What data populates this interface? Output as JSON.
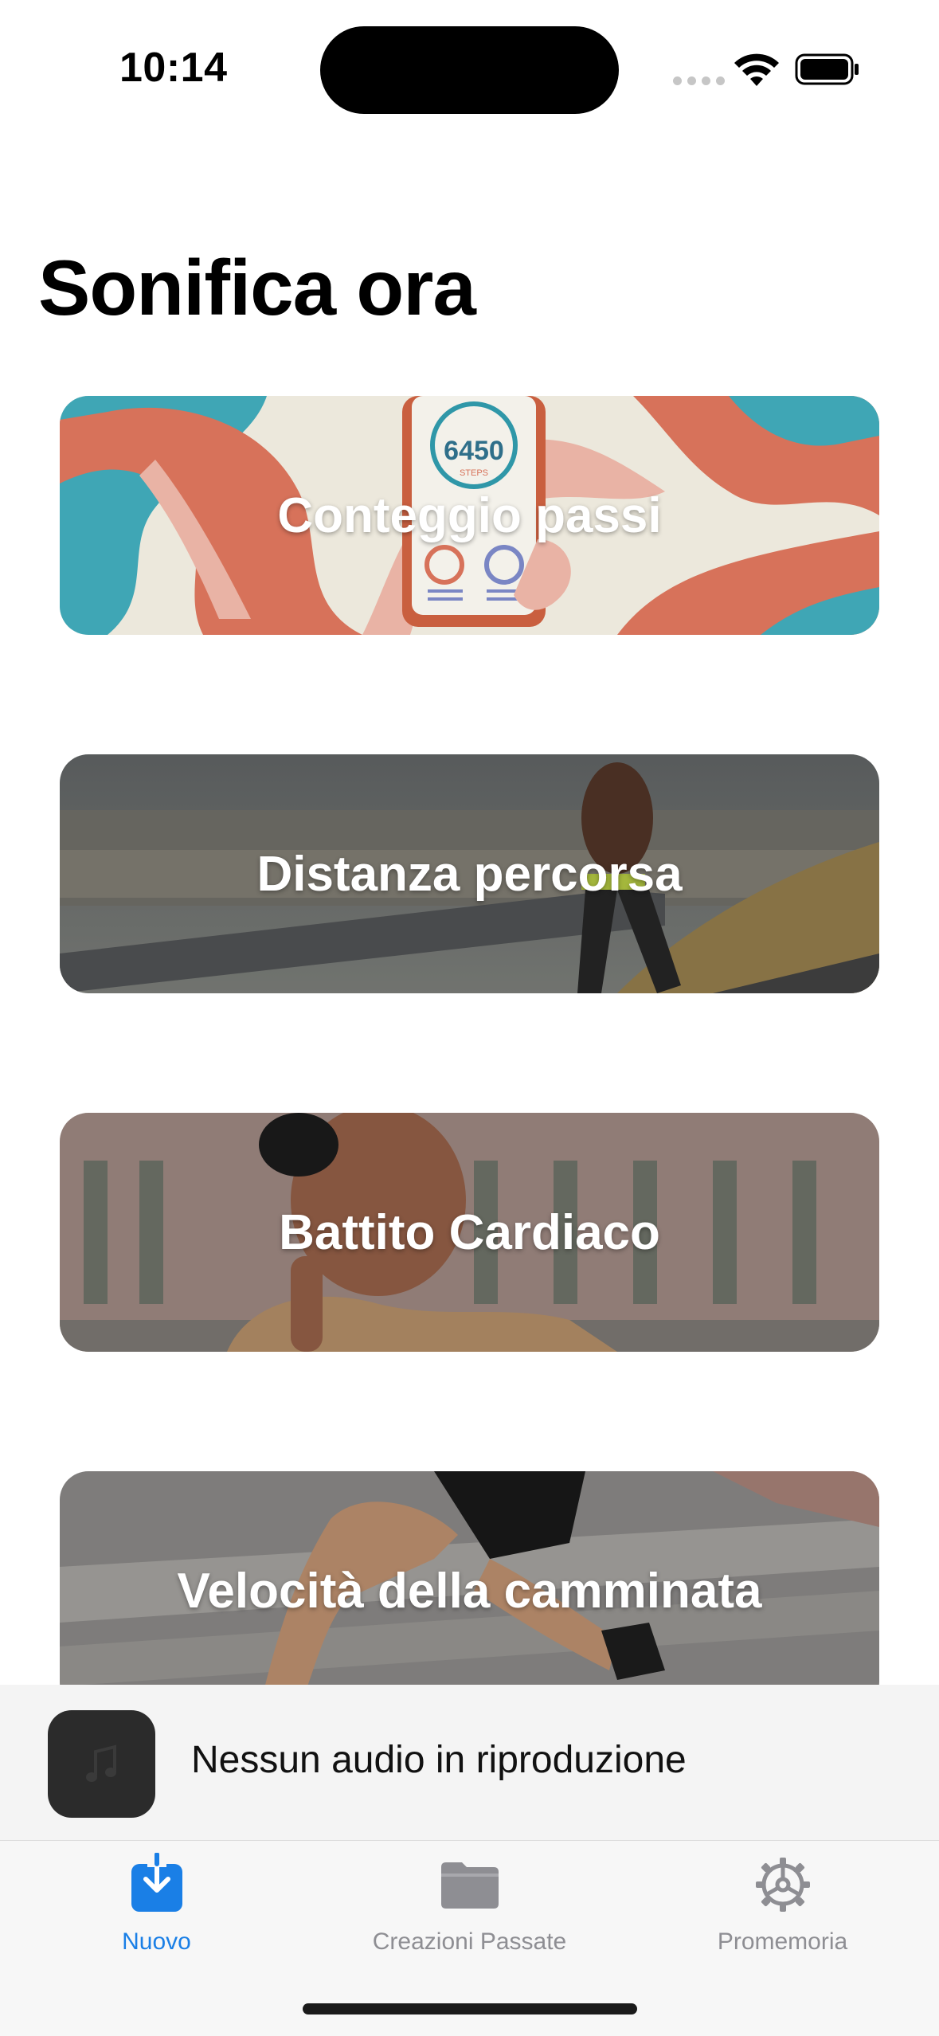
{
  "status_bar": {
    "time": "10:14"
  },
  "page": {
    "title": "Sonifica ora"
  },
  "cards": [
    {
      "label": "Conteggio passi",
      "image_text": "6450",
      "image_subtext": "STEPS"
    },
    {
      "label": "Distanza percorsa"
    },
    {
      "label": "Battito Cardiaco"
    },
    {
      "label": "Velocità della camminata"
    }
  ],
  "mini_player": {
    "status": "Nessun audio in riproduzione",
    "artwork_icon": "music-note-icon"
  },
  "tabs": [
    {
      "label": "Nuovo",
      "icon": "download-tray-icon",
      "active": true
    },
    {
      "label": "Creazioni Passate",
      "icon": "folder-icon",
      "active": false
    },
    {
      "label": "Promemoria",
      "icon": "gear-icon",
      "active": false
    }
  ],
  "colors": {
    "accent": "#1a7fe6",
    "inactive": "#8e8e93"
  }
}
